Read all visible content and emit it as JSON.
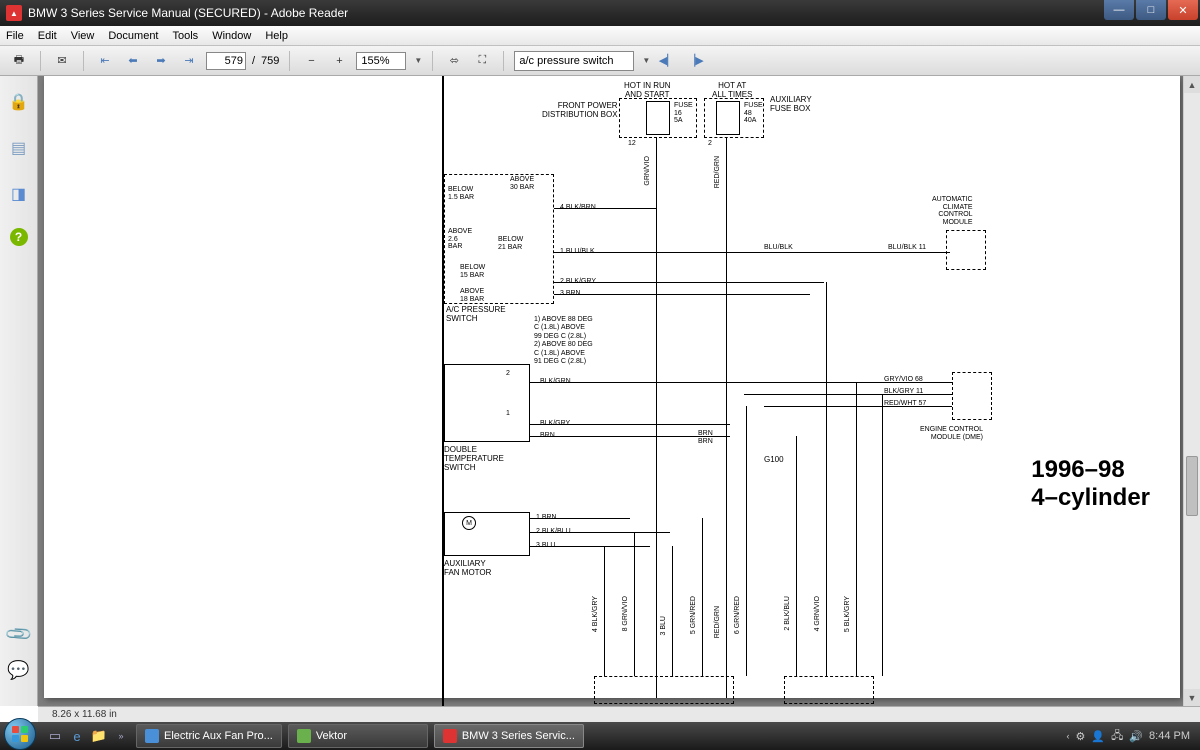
{
  "window": {
    "title": "BMW 3 Series Service Manual (SECURED) - Adobe Reader"
  },
  "menu": {
    "items": [
      "File",
      "Edit",
      "View",
      "Document",
      "Tools",
      "Window",
      "Help"
    ]
  },
  "toolbar": {
    "page_current": "579",
    "page_total": "759",
    "page_sep": "/",
    "zoom": "155%",
    "search_value": "a/c pressure switch"
  },
  "status": {
    "dimensions": "8.26 x 11.68 in"
  },
  "diagram": {
    "top_labels": {
      "hot_run": "HOT IN RUN\nAND START",
      "hot_at": "HOT AT\nALL TIMES",
      "front_power": "FRONT POWER\nDISTRIBUTION BOX",
      "aux_fusebox": "AUXILIARY\nFUSE BOX",
      "fuse16": "FUSE\n16\n5A",
      "fuse48": "FUSE\n48\n40A",
      "pin12": "12",
      "pin2": "2"
    },
    "pressure_switch": {
      "name": "A/C PRESSURE\nSWITCH",
      "above_30": "ABOVE\n30 BAR",
      "below_15": "BELOW\n1.5 BAR",
      "above_26": "ABOVE\n2.6\nBAR",
      "below_21": "BELOW\n21 BAR",
      "below_15b": "BELOW\n15 BAR",
      "above_18": "ABOVE\n18 BAR",
      "w4": "4  BLK/BRN",
      "w1": "1   BLU/BLK",
      "w2": "2  BLK/GRY",
      "w3": "3  BRN"
    },
    "temp_notes": "1) ABOVE 88 DEG\nC (1.8L) ABOVE\n99 DEG C (2.8L)\n2) ABOVE 80 DEG\nC (1.8L) ABOVE\n91 DEG C (2.8L)",
    "temp_switch": {
      "name": "DOUBLE\nTEMPERATURE\nSWITCH",
      "pin2": "2",
      "pin1": "1",
      "w_blkgrn": "BLK/GRN",
      "w_blkgry": "BLK/GRY",
      "w_brn": "BRN"
    },
    "fan_motor": {
      "name": "AUXILIARY\nFAN MOTOR",
      "m": "M",
      "w1": "1   BRN",
      "w2": "2  BLK/BLU",
      "w3": "3  BLU"
    },
    "climate": {
      "name": "AUTOMATIC\nCLIMATE\nCONTROL\nMODULE",
      "blu_blk": "BLU/BLK",
      "pin11": "BLU/BLK  11"
    },
    "ecm": {
      "name": "ENGINE CONTROL\nMODULE (DME)",
      "gry_vio": "GRY/VIO  68",
      "blk_gry": "BLK/GRY  11",
      "red_wht": "RED/WHT  57"
    },
    "g100": "G100",
    "brn_labels": "BRN\nBRN",
    "vert_wires": {
      "grn_vio": "GRN/VIO",
      "red_grn": "RED/GRN",
      "blk_gry4": "4   BLK/GRY",
      "grn_vio8": "8   GRN/VIO",
      "blu3": "3   BLU",
      "grn_red5": "5   GRN/RED",
      "red_grn_v": "RED/GRN",
      "grn_red6": "6   GRN/RED",
      "blk_blu2": "2   BLK/BLU",
      "grn_vio4": "4   GRN/VIO",
      "blk_gry5": "5   BLK/GRY"
    },
    "year_model": "1996–98\n4–cylinder"
  },
  "taskbar": {
    "items": [
      {
        "label": "Electric Aux Fan Pro...",
        "color": "#4a90d9"
      },
      {
        "label": "Vektor",
        "color": "#6ab04c"
      },
      {
        "label": "BMW 3 Series Servic...",
        "color": "#d33"
      }
    ],
    "time": "8:44 PM"
  }
}
